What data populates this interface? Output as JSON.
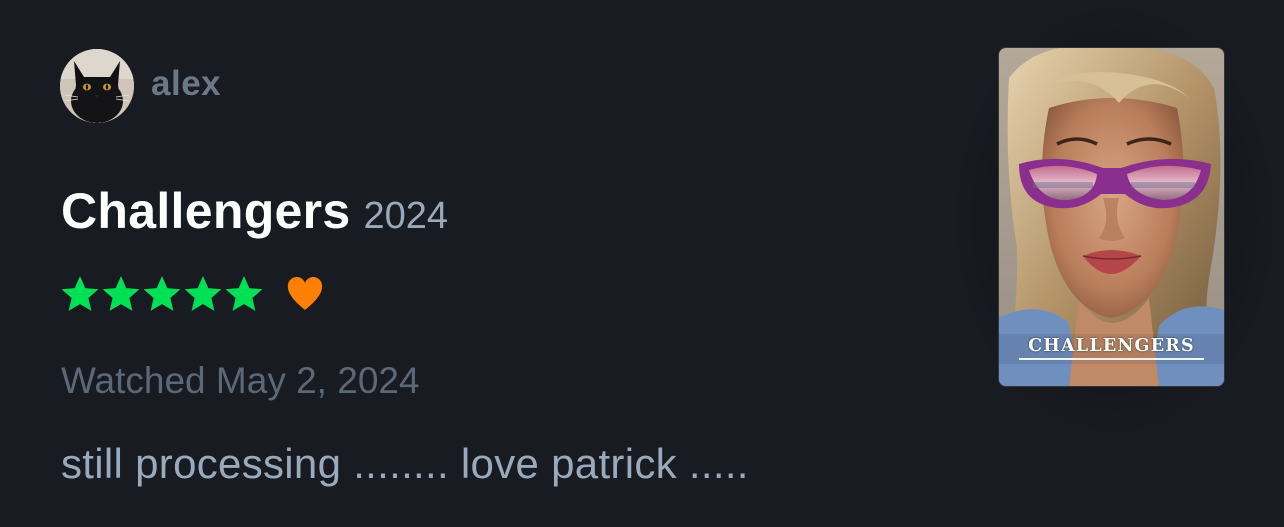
{
  "user": {
    "name": "alex",
    "avatar_icon": "black-cat-avatar"
  },
  "film": {
    "title": "Challengers",
    "year": "2024",
    "poster_title": "CHALLENGERS"
  },
  "rating": {
    "stars": 5,
    "max_stars": 5,
    "liked": true,
    "star_color": "#00e054",
    "heart_color": "#ff8000"
  },
  "watched_text": "Watched May 2, 2024",
  "review_text": "still processing ........ love patrick .....",
  "colors": {
    "background": "#181b21",
    "title": "#ffffff",
    "muted": "#5b6878",
    "text": "#9aa9bb"
  }
}
